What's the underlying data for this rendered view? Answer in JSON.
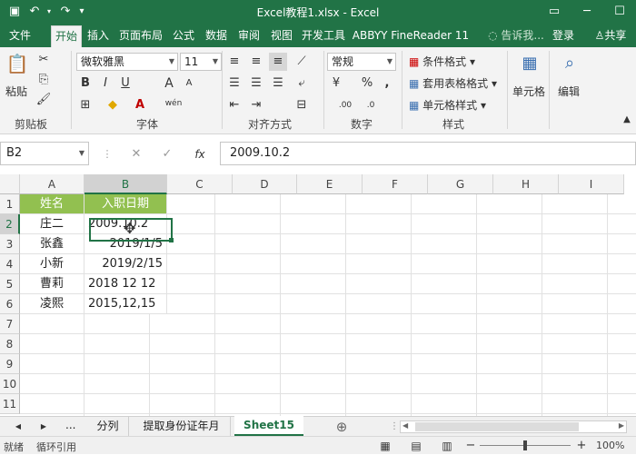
{
  "title": "Excel教程1.xlsx - Excel",
  "tabs": [
    "文件",
    "开始",
    "插入",
    "页面布局",
    "公式",
    "数据",
    "审阅",
    "视图",
    "开发工具",
    "ABBYY FineReader 11"
  ],
  "tell_me": "告诉我...",
  "sign_in": "登录",
  "share": "共享",
  "ribbon": {
    "clipboard": {
      "paste": "粘贴",
      "label": "剪贴板"
    },
    "font": {
      "name": "微软雅黑",
      "size": "11",
      "label": "字体",
      "bold": "B",
      "italic": "I",
      "underline": "U",
      "grow": "A",
      "shrink": "A",
      "phonetic": "wén"
    },
    "alignment": {
      "label": "对齐方式"
    },
    "number": {
      "format": "常规",
      "label": "数字",
      "currency": "¥",
      "percent": "%",
      "comma": ","
    },
    "styles": {
      "cond": "条件格式",
      "table": "套用表格格式",
      "cell": "单元格样式",
      "label": "样式"
    },
    "cells": {
      "label": "单元格"
    },
    "editing": {
      "label": "编辑"
    }
  },
  "formula_bar": {
    "name_box": "B2",
    "fx": "fx",
    "content": "2009.10.2"
  },
  "columns": [
    "A",
    "B",
    "C",
    "D",
    "E",
    "F",
    "G",
    "H",
    "I"
  ],
  "rows": [
    "1",
    "2",
    "3",
    "4",
    "5",
    "6",
    "7",
    "8",
    "9",
    "10",
    "11"
  ],
  "cells": {
    "A1": "姓名",
    "B1": "入职日期",
    "A2": "庄二",
    "B2": "2009.10.2",
    "A3": "张鑫",
    "B3": "2019/1/5",
    "A4": "小新",
    "B4": "2019/2/15",
    "A5": "曹莉",
    "B5": "2018 12 12",
    "A6": "凌熙",
    "B6": "2015,12,15"
  },
  "sheet_tabs": [
    "分列",
    "提取身份证年月",
    "Sheet15"
  ],
  "active_sheet": "Sheet15",
  "sheet_more": "...",
  "status": {
    "ready": "就绪",
    "circular": "循环引用",
    "zoom": "100%"
  },
  "colors": {
    "excel_green": "#217346",
    "header_fill": "#92c050",
    "selected": "#217346"
  }
}
